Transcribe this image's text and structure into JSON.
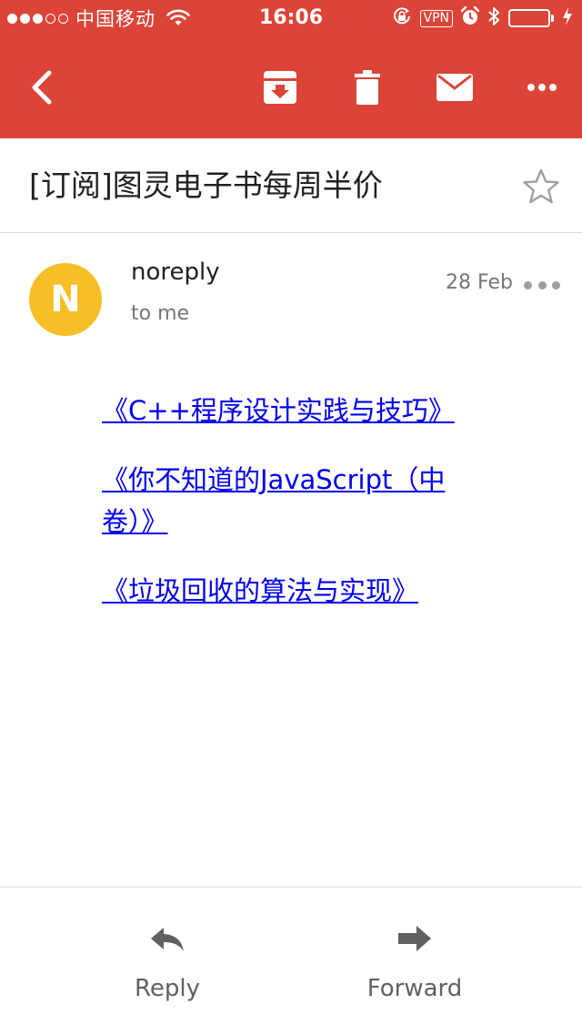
{
  "status_bar": {
    "carrier": "中国移动",
    "time": "16:06",
    "vpn": "VPN"
  },
  "toolbar": {
    "icons": [
      "back-arrow-icon",
      "archive-icon",
      "delete-icon",
      "mail-icon",
      "more-vert-icon"
    ],
    "accent_color": "#db4437"
  },
  "email": {
    "subject": "[订阅]图灵电子书每周半价",
    "starred": false,
    "sender": {
      "name": "noreply",
      "initial": "N",
      "avatar_color": "#f6bf26"
    },
    "recipient": "to me",
    "date": "28 Feb",
    "links": [
      "《C++程序设计实践与技巧》",
      "《你不知道的JavaScript（中卷）》",
      "《垃圾回收的算法与实现》"
    ]
  },
  "actions": {
    "reply_label": "Reply",
    "forward_label": "Forward"
  }
}
